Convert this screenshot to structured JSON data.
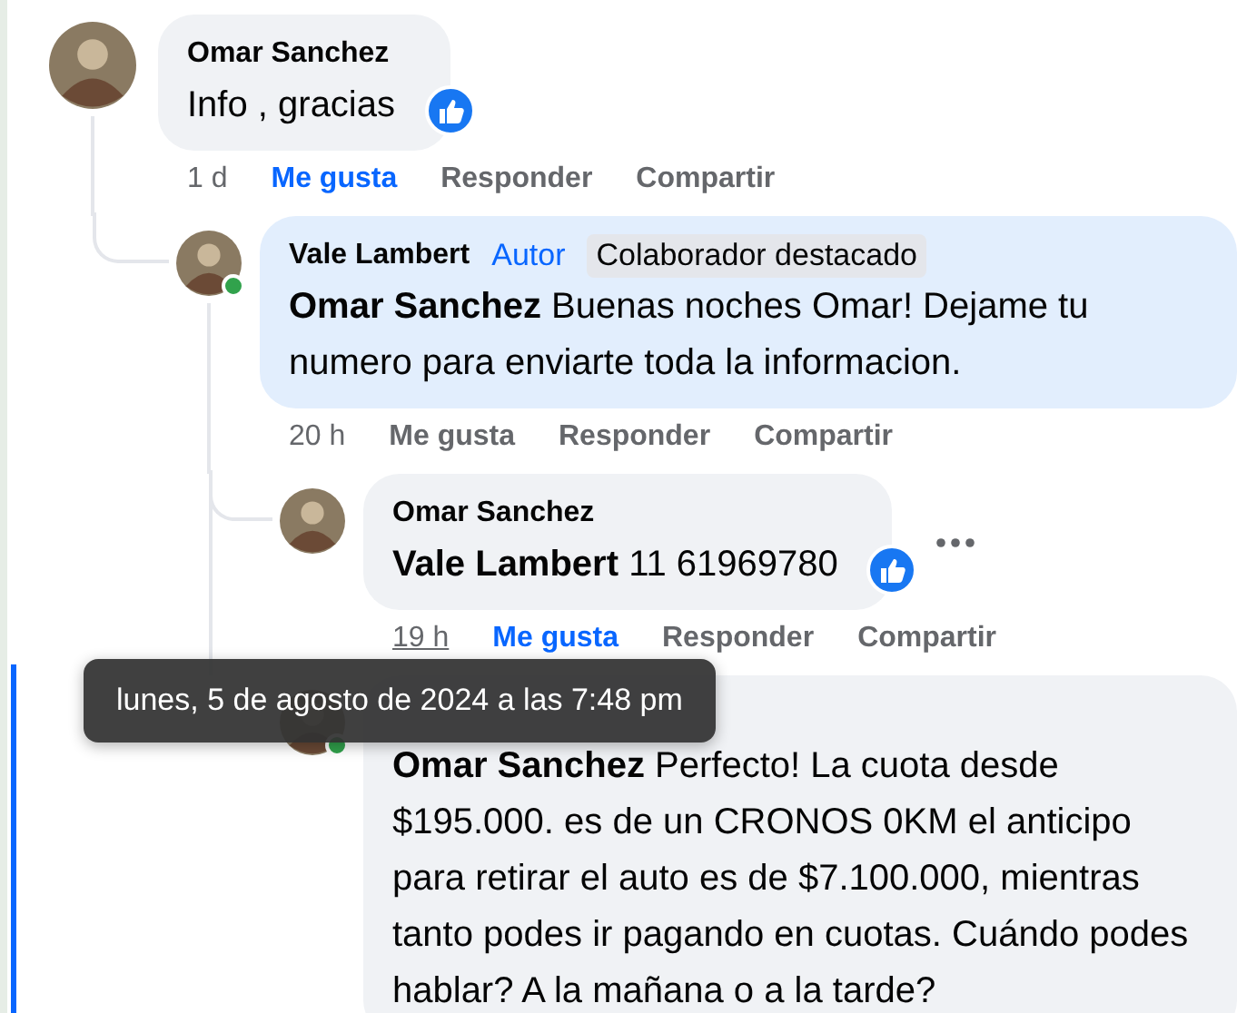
{
  "comments": [
    {
      "author": "Omar Sanchez",
      "online": false,
      "body": "Info , gracias",
      "has_reaction": true,
      "more_menu": false,
      "time": "1 d",
      "time_hovered": false,
      "liked": true,
      "like_label": "Me gusta",
      "reply_label": "Responder",
      "share_label": "Compartir",
      "children": [
        {
          "author": "Vale Lambert",
          "online": true,
          "badges": [
            {
              "kind": "role",
              "label": "Autor"
            },
            {
              "kind": "badge",
              "label": "Colaborador destacado"
            }
          ],
          "body": "**Omar Sanchez** Buenas noches Omar! Dejame tu numero para enviarte toda la informacion.",
          "by_author": true,
          "has_reaction": false,
          "more_menu": false,
          "time": "20 h",
          "time_hovered": false,
          "liked": false,
          "like_label": "Me gusta",
          "reply_label": "Responder",
          "share_label": "Compartir",
          "children": [
            {
              "author": "Omar Sanchez",
              "online": false,
              "body": "**Vale Lambert** 11 61969780",
              "has_reaction": true,
              "more_menu": true,
              "time": "19 h",
              "time_hovered": true,
              "liked": true,
              "like_label": "Me gusta",
              "reply_label": "Responder",
              "share_label": "Compartir"
            },
            {
              "online": true,
              "highlighted": true,
              "body": "**Omar Sanchez** Perfecto! La cuota desde $195.000. es de un CRONOS 0KM el anticipo para retirar el auto es de $7.100.000, mientras tanto podes ir pagando en cuotas. Cuándo podes hablar? A la mañana o a la tarde?",
              "has_reaction": false,
              "more_menu": false
            }
          ]
        }
      ]
    }
  ],
  "tooltip": "lunes, 5 de agosto de 2024 a las 7:48 pm"
}
